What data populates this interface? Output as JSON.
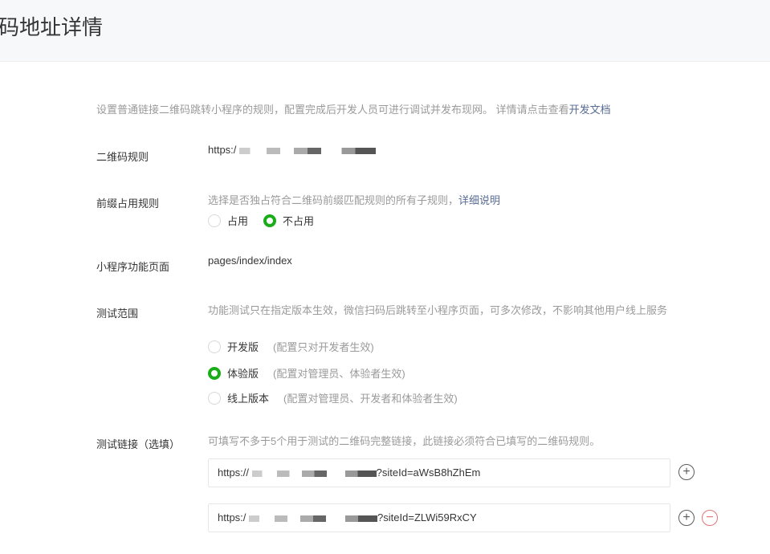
{
  "header": {
    "title": "码地址详情"
  },
  "description": {
    "text": "设置普通链接二维码跳转小程序的规则，配置完成后开发人员可进行调试并发布现网。 详情请点击查看",
    "link": "开发文档"
  },
  "qr_rule": {
    "label": "二维码规则",
    "value": "https:/"
  },
  "prefix_rule": {
    "label": "前缀占用规则",
    "tip": "选择是否独占符合二维码前缀匹配规则的所有子规则，",
    "link": "详细说明",
    "options": [
      {
        "label": "占用",
        "checked": false
      },
      {
        "label": "不占用",
        "checked": true
      }
    ]
  },
  "page": {
    "label": "小程序功能页面",
    "value": "pages/index/index"
  },
  "test_scope": {
    "label": "测试范围",
    "tip": "功能测试只在指定版本生效，微信扫码后跳转至小程序页面，可多次修改，不影响其他用户线上服务",
    "options": [
      {
        "label": "开发版",
        "note": "(配置只对开发者生效)",
        "checked": false
      },
      {
        "label": "体验版",
        "note": "(配置对管理员、体验者生效)",
        "checked": true
      },
      {
        "label": "线上版本",
        "note": "(配置对管理员、开发者和体验者生效)",
        "checked": false
      }
    ]
  },
  "test_links": {
    "label": "测试链接（选填）",
    "tip": "可填写不多于5个用于测试的二维码完整链接，此链接必须符合已填写的二维码规则。",
    "links": [
      {
        "prefix": "https://",
        "suffix": "?siteId=aWsB8hZhEm"
      },
      {
        "prefix": "https:/",
        "suffix": "?siteId=ZLWi59RxCY"
      }
    ],
    "add_icon": "plus-circle-icon",
    "remove_icon": "minus-circle-icon"
  },
  "colors": {
    "accent": "#1aad19",
    "link": "#576b95",
    "danger": "#e07575"
  }
}
